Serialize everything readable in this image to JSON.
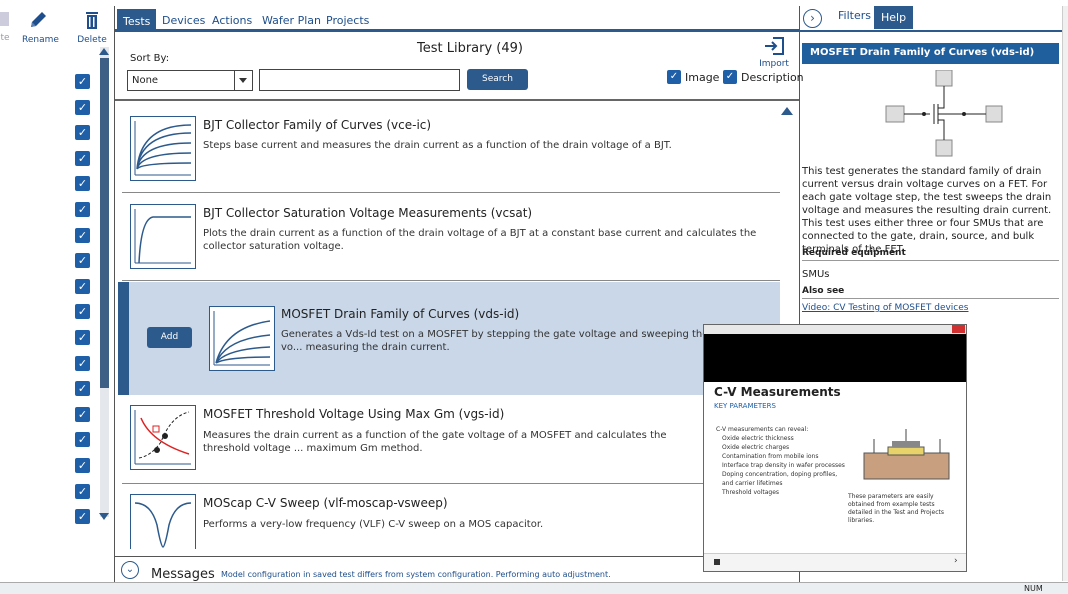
{
  "toolbar": {
    "rename_label": "Rename",
    "delete_label": "Delete",
    "partial_label": "te"
  },
  "tabs": [
    "Tests",
    "Devices",
    "Actions",
    "Wafer Plan",
    "Projects"
  ],
  "library": {
    "title": "Test Library (49)",
    "sort_by_label": "Sort By:",
    "sort_value": "None",
    "search_placeholder": "",
    "search_label": "Search",
    "import_label": "Import",
    "image_label": "Image",
    "description_label": "Description",
    "add_label": "Add"
  },
  "tests": [
    {
      "title": "BJT Collector Family of Curves (vce-ic)",
      "desc": "Steps base current and measures the drain current as a function of the drain voltage of a BJT."
    },
    {
      "title": "BJT Collector Saturation Voltage Measurements (vcsat)",
      "desc": "Plots the drain current as a function of the drain voltage of a BJT at a constant base current and calculates the collector saturation voltage."
    },
    {
      "title": "MOSFET Drain Family of Curves (vds-id)",
      "desc": "Generates a Vds-Id test on a MOSFET by stepping the gate voltage and sweeping the drain vo... measuring the drain current."
    },
    {
      "title": "MOSFET Threshold Voltage Using Max Gm (vgs-id)",
      "desc": "Measures the drain current as a function of the gate voltage of a MOSFET and calculates the threshold voltage ... maximum Gm method."
    },
    {
      "title": "MOScap C-V Sweep (vlf-moscap-vsweep)",
      "desc": "Performs a very-low frequency (VLF) C-V sweep on a MOS capacitor."
    }
  ],
  "messages": {
    "label": "Messages",
    "text": "Model configuration in saved test differs from system configuration. Performing auto adjustment."
  },
  "right_panel": {
    "tabs": [
      "Filters",
      "Help"
    ],
    "heading": "MOSFET Drain Family of Curves (vds-id)",
    "body": "This test generates the standard family of drain current versus drain voltage curves on a FET. For each gate voltage step, the test sweeps the drain voltage and measures the resulting drain current. This test uses either three or four SMUs that are connected to the gate, drain, source, and bulk terminals of the FET.",
    "required_label": "Required equipment",
    "required_value": "SMUs",
    "also_label": "Also see",
    "link": "Video: CV Testing of MOSFET devices"
  },
  "video": {
    "slide_title": "C-V Measurements",
    "slide_sub": "KEY PARAMETERS",
    "bullets": [
      "C-V measurements can reveal:",
      "Oxide electric thickness",
      "Oxide electric charges",
      "Contamination from mobile ions",
      "Interface trap density in wafer processes",
      "Doping concentration, doping profiles, and carrier lifetimes",
      "Threshold voltages"
    ],
    "caption": "These parameters are easily obtained from example tests detailed in the Test and Projects libraries."
  },
  "status": {
    "num": "NUM"
  },
  "colors": {
    "accent": "#2c5a8c",
    "selected_row": "#c9d7e8",
    "help_header": "#1f5f9e"
  }
}
